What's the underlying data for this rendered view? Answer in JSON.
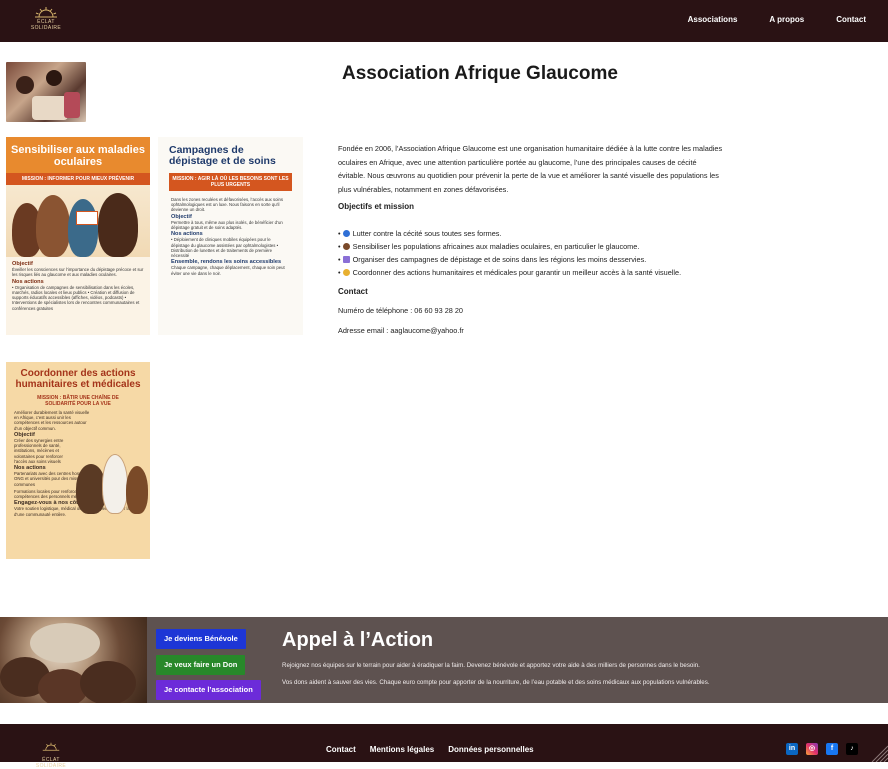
{
  "header": {
    "logo_text": "ÉCLAT SOLIDAIRE",
    "nav": [
      "Associations",
      "A propos",
      "Contact"
    ]
  },
  "main": {
    "title": "Association Afrique Glaucome",
    "intro": "Fondée en 2006, l’Association Afrique Glaucome est une organisation humanitaire dédiée à la lutte contre les maladies oculaires en Afrique, avec une attention particulière portée au glaucome, l’une des principales causes de cécité évitable. Nous œuvrons au quotidien pour prévenir la perte de la vue et améliorer la santé visuelle des populations les plus vulnérables, notamment en zones défavorisées.",
    "objectives_heading": "Objectifs et mission",
    "objectives": [
      {
        "icon": "globe-icon",
        "color": "#2f6fd6",
        "text": "Lutter contre la cécité sous toutes ses formes."
      },
      {
        "icon": "eye-icon",
        "color": "#7a4a2a",
        "text": "Sensibiliser les populations africaines aux maladies oculaires, en particulier le glaucome."
      },
      {
        "icon": "clipboard-icon",
        "color": "#8a6fd6",
        "text": "Organiser des campagnes de dépistage et de soins dans les régions les moins desservies."
      },
      {
        "icon": "handshake-icon",
        "color": "#e8b030",
        "text": "Coordonner des actions humanitaires et médicales pour garantir un meilleur accès à la santé visuelle."
      }
    ],
    "contact_heading": "Contact",
    "phone": "Numéro de téléphone : 06 60 93 28 20",
    "email": "Adresse email : aaglaucome@yahoo.fr"
  },
  "posters": {
    "p1": {
      "title": "Sensibiliser aux maladies oculaires",
      "mission": "MISSION : INFORMER POUR MIEUX PRÉVENIR",
      "objectif_h": "Objectif",
      "objectif": "Éveiller les consciences sur l’importance du dépistage précoce et sur les risques liés au glaucome et aux maladies oculaires.",
      "actions_h": "Nos actions",
      "actions": "• Organisation de campagnes de sensibilisation dans les écoles, marchés, radios locales et lieux publics • Création et diffusion de supports éducatifs accessibles (affiches, vidéos, podcasts) • Interventions de spécialistes lors de rencontres communautaires et conférences gratuites"
    },
    "p2": {
      "title": "Campagnes de dépistage et de soins",
      "mission": "MISSION : AGIR LÀ OÙ LES BESOINS SONT LES PLUS URGENTS",
      "intro": "Dans les zones reculées et défavorisées, l’accès aux soins ophtalmologiques est un luxe. Nous faisons en sorte qu’il devienne un droit.",
      "objectif_h": "Objectif",
      "objectif": "Permettre à tous, même aux plus isolés, de bénéficier d’un dépistage gratuit et de soins adaptés.",
      "actions_h": "Nos actions",
      "actions": "• Déploiement de cliniques mobiles équipées pour le dépistage du glaucome assistées par ophtalmologistes • Distribution de lunettes et de traitements de première nécessité",
      "closing_h": "Ensemble, rendons les soins accessibles",
      "closing": "Chaque campagne, chaque déplacement, chaque soin peut éviter une vie dans le noir."
    },
    "p3": {
      "title": "Coordonner des actions humanitaires et médicales",
      "mission": "MISSION : BÂTIR UNE CHAÎNE DE SOLIDARITÉ POUR LA VUE",
      "intro": "Améliorer durablement la santé visuelle en Afrique, c’est aussi unir les compétences et les ressources autour d’un objectif commun.",
      "objectif_h": "Objectif",
      "objectif": "Créer des synergies entre professionnels de santé, institutions, mécènes et volontaires pour renforcer l’accès aux soins visuels",
      "actions_h": "Nos actions",
      "actions": "Partenariats avec des centres hospitaliers ONG et universités pour des missions communes",
      "formation": "Formations locales pour renforcer les compétences des personnels médicaux",
      "engage_h": "Engagez-vous à nos côtés",
      "engage": "Votre soutien logistique, médical ou financier peut changer la vie d’une communauté entière."
    }
  },
  "cta": {
    "buttons": [
      "Je deviens Bénévole",
      "Je veux faire un Don",
      "Je contacte l’association"
    ],
    "button_colors": [
      "#1d36d6",
      "#28882a",
      "#6c2bd9"
    ],
    "title": "Appel à l’Action",
    "p1": "Rejoignez nos équipes sur le terrain pour aider à éradiquer la faim. Devenez bénévole et apportez votre aide à des milliers de personnes dans le besoin.",
    "p2": "Vos dons aident à sauver des vies. Chaque euro compte pour apporter de la nourriture, de l’eau potable et des soins médicaux aux populations vulnérables."
  },
  "footer": {
    "logo_text": "ÉCLAT SOLIDAIRE",
    "links": [
      "Contact",
      "Mentions légales",
      "Données personnelles"
    ],
    "social": [
      "linkedin-icon",
      "instagram-icon",
      "facebook-icon",
      "tiktok-icon"
    ]
  },
  "colors": {
    "header_bg": "#2a1214",
    "cta_bg": "#5e5250",
    "poster_orange": "#e88a2e",
    "poster_accent": "#d4561f"
  }
}
